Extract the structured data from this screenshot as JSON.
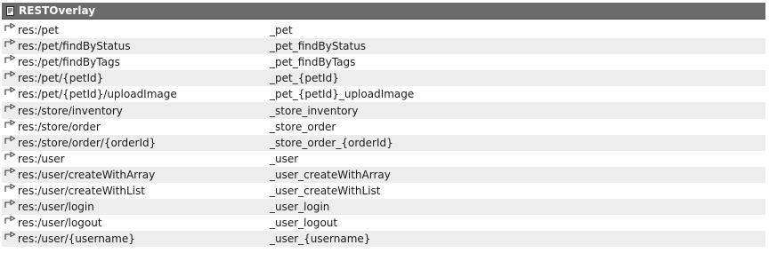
{
  "panel": {
    "title": "RESTOverlay",
    "title_icon": "document-icon",
    "row_icon": "link-arrow-icon",
    "header_color": "#6b6b6b",
    "alt_row_color": "#ededed"
  },
  "rows": [
    {
      "path": "res:/pet",
      "target": "_pet"
    },
    {
      "path": "res:/pet/findByStatus",
      "target": "_pet_findByStatus"
    },
    {
      "path": "res:/pet/findByTags",
      "target": "_pet_findByTags"
    },
    {
      "path": "res:/pet/{petId}",
      "target": "_pet_{petId}"
    },
    {
      "path": "res:/pet/{petId}/uploadImage",
      "target": "_pet_{petId}_uploadImage"
    },
    {
      "path": "res:/store/inventory",
      "target": "_store_inventory"
    },
    {
      "path": "res:/store/order",
      "target": "_store_order"
    },
    {
      "path": "res:/store/order/{orderId}",
      "target": "_store_order_{orderId}"
    },
    {
      "path": "res:/user",
      "target": "_user"
    },
    {
      "path": "res:/user/createWithArray",
      "target": "_user_createWithArray"
    },
    {
      "path": "res:/user/createWithList",
      "target": "_user_createWithList"
    },
    {
      "path": "res:/user/login",
      "target": "_user_login"
    },
    {
      "path": "res:/user/logout",
      "target": "_user_logout"
    },
    {
      "path": "res:/user/{username}",
      "target": "_user_{username}"
    }
  ]
}
